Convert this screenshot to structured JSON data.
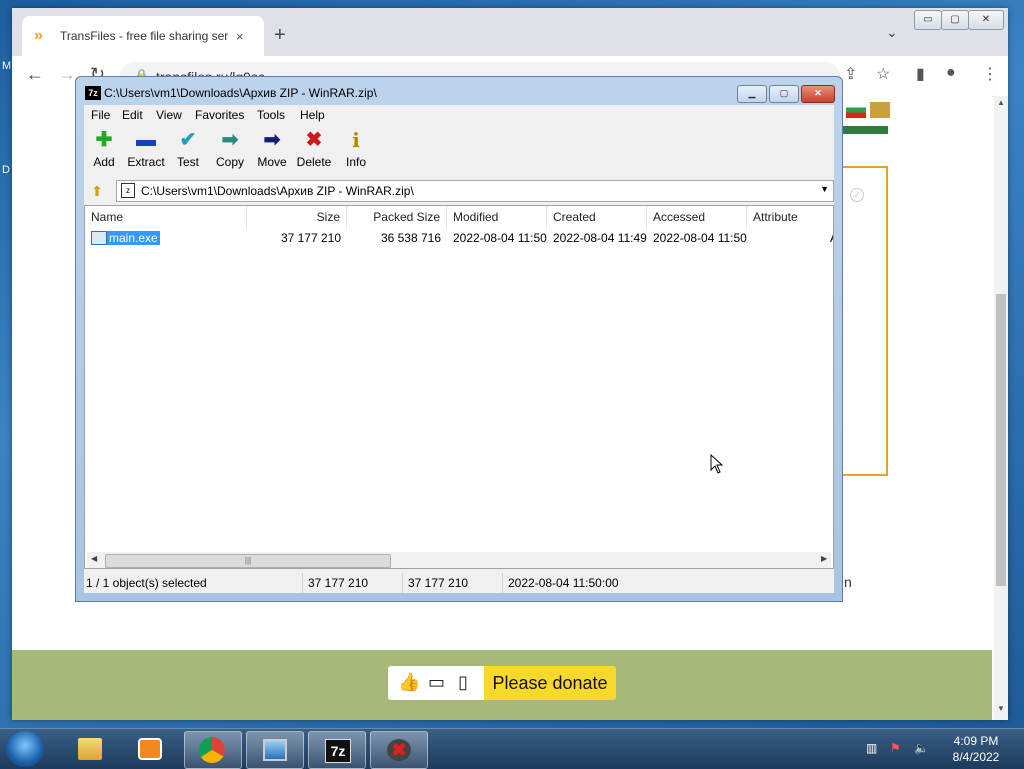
{
  "desktop": {
    "letters": [
      "M",
      "D"
    ]
  },
  "browser": {
    "tab_title": "TransFiles - free file sharing servi",
    "tab_close": "×",
    "new_tab": "+",
    "tab_menu": "⌄",
    "url": "transfiles.ru/lq9sc",
    "window_buttons": [
      "▭",
      "▢",
      "✕"
    ],
    "page": {
      "partial_text": "n",
      "donate_label": "Please donate"
    }
  },
  "zip": {
    "title": "C:\\Users\\vm1\\Downloads\\Архив ZIP - WinRAR.zip\\",
    "logo": "7z",
    "menu": [
      "File",
      "Edit",
      "View",
      "Favorites",
      "Tools",
      "Help"
    ],
    "tools": [
      {
        "label": "Add",
        "icon": "add-icon",
        "glyph": "✚",
        "color": "#22aa22"
      },
      {
        "label": "Extract",
        "icon": "extract-icon",
        "glyph": "▬",
        "color": "#1a3fbf"
      },
      {
        "label": "Test",
        "icon": "test-icon",
        "glyph": "✔",
        "color": "#20a0c0"
      },
      {
        "label": "Copy",
        "icon": "copy-icon",
        "glyph": "➡",
        "color": "#2a8a80"
      },
      {
        "label": "Move",
        "icon": "move-icon",
        "glyph": "➡",
        "color": "#10207a"
      },
      {
        "label": "Delete",
        "icon": "delete-icon",
        "glyph": "✖",
        "color": "#d01818"
      },
      {
        "label": "Info",
        "icon": "info-icon",
        "glyph": "i",
        "color": "#b08a00"
      }
    ],
    "address": "C:\\Users\\vm1\\Downloads\\Архив ZIP - WinRAR.zip\\",
    "columns": [
      "Name",
      "Size",
      "Packed Size",
      "Modified",
      "Created",
      "Accessed",
      "Attribute"
    ],
    "rows": [
      {
        "name": "main.exe",
        "size": "37 177 210",
        "packed": "36 538 716",
        "modified": "2022-08-04 11:50",
        "created": "2022-08-04 11:49",
        "accessed": "2022-08-04 11:50",
        "attribute": "A"
      }
    ],
    "status": {
      "selection": "1 / 1 object(s) selected",
      "size": "37 177 210",
      "packed": "37 177 210",
      "modified": "2022-08-04 11:50:00"
    }
  },
  "taskbar": {
    "apps": [
      "explorer-icon",
      "media-player-icon",
      "chrome-icon",
      "remote-desktop-icon",
      "7zip-icon",
      "close-app-icon"
    ],
    "app_7z_label": "7z",
    "time": "4:09 PM",
    "date": "8/4/2022"
  }
}
